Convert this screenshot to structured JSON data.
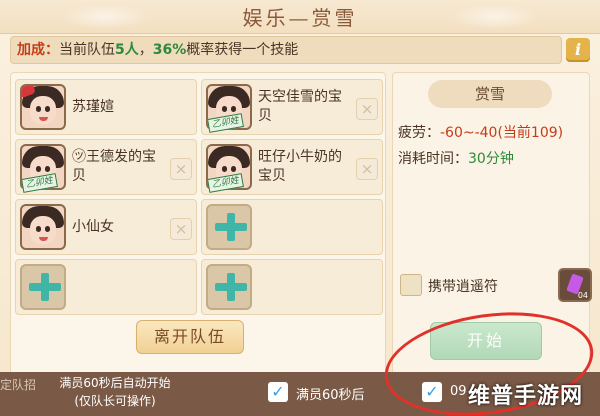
{
  "window": {
    "title": "娱乐—赏雪"
  },
  "bonus": {
    "prefix": "加成：",
    "text_a": "当前队伍",
    "count": "5人",
    "text_b": "，",
    "percent": "36%",
    "text_c": "概率获得一个技能",
    "info_label": "i"
  },
  "members": [
    {
      "name": "苏瑾媗",
      "badge": "",
      "kick": ""
    },
    {
      "name": "天空佳雪的宝贝",
      "badge": "乙卯姓",
      "kick": "×"
    },
    {
      "name": "㋡王德发的宝贝",
      "badge": "乙卯姓",
      "kick": "×"
    },
    {
      "name": "旺仔小牛奶的宝贝",
      "badge": "乙卯姓",
      "kick": "×"
    },
    {
      "name": "小仙女",
      "badge": "",
      "kick": "×"
    }
  ],
  "leave_button": "离开队伍",
  "side": {
    "title": "赏雪",
    "fatigue_label": "疲劳：",
    "fatigue_value": "-60~-40",
    "fatigue_current": "(当前109)",
    "time_label": "消耗时间：",
    "time_value": "30分钟",
    "charm_label": "携带逍遥符",
    "charm_count": "04",
    "start_button": "开始"
  },
  "bottom": {
    "left_text": "定队招",
    "tip_line1": "满员60秒后自动开始",
    "tip_line2": "(仅队长可操作)",
    "check1_label": "满员60秒后",
    "check2_label": "09",
    "check_mark": "✓"
  },
  "watermark": "维普手游网"
}
